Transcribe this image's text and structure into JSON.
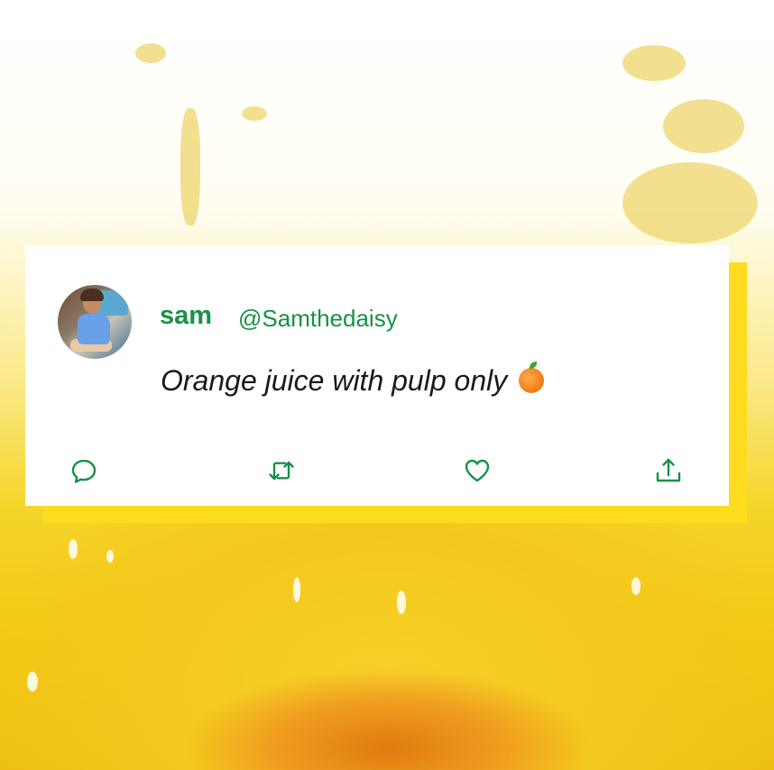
{
  "tweet": {
    "display_name": "sam",
    "handle": "@Samthedaisy",
    "text": "Orange juice with pulp only",
    "emoji": "orange-emoji"
  },
  "actions": [
    {
      "name": "reply-icon"
    },
    {
      "name": "retweet-icon"
    },
    {
      "name": "like-icon"
    },
    {
      "name": "share-icon"
    }
  ],
  "colors": {
    "accent": "#179146",
    "card": "#ffffff",
    "shadow": "#fddc1f",
    "juice": "#f3c81c"
  }
}
